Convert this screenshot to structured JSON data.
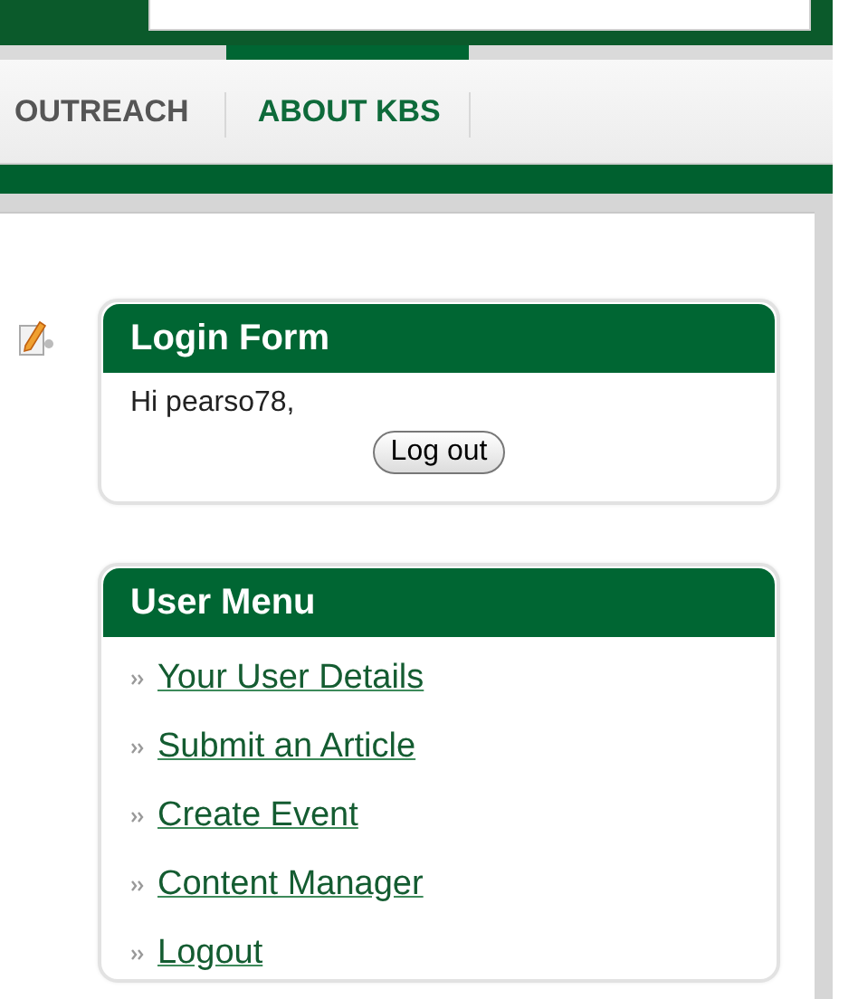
{
  "nav": {
    "items": [
      {
        "label": "OUTREACH",
        "selected": false
      },
      {
        "label": "ABOUT KBS",
        "selected": true
      }
    ]
  },
  "login_form": {
    "title": "Login Form",
    "greeting": "Hi pearso78,",
    "button": "Log out"
  },
  "user_menu": {
    "title": "User Menu",
    "items": [
      {
        "label": "Your User Details"
      },
      {
        "label": "Submit an Article"
      },
      {
        "label": "Create Event"
      },
      {
        "label": "Content Manager"
      },
      {
        "label": "Logout"
      }
    ]
  }
}
